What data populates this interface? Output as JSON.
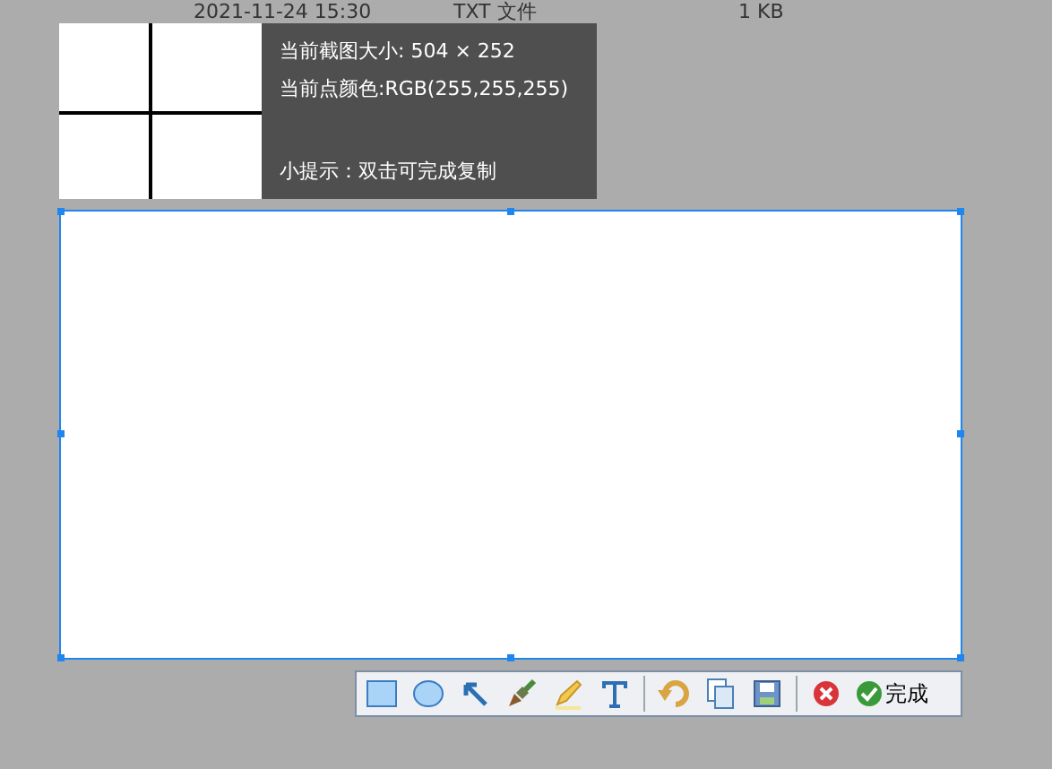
{
  "file_row": {
    "date": "2021-11-24 15:30",
    "type": "TXT 文件",
    "size": "1 KB"
  },
  "info": {
    "size_line": "当前截图大小: 504 × 252",
    "color_line": "当前点颜色:RGB(255,255,255)",
    "hint": "小提示：双击可完成复制"
  },
  "toolbar": {
    "tools": [
      {
        "kind": "rectangle"
      },
      {
        "kind": "ellipse"
      },
      {
        "kind": "arrow"
      },
      {
        "kind": "brush"
      },
      {
        "kind": "pencil"
      },
      {
        "kind": "text"
      },
      {
        "kind": "separator"
      },
      {
        "kind": "undo"
      },
      {
        "kind": "copy"
      },
      {
        "kind": "save"
      },
      {
        "kind": "separator"
      },
      {
        "kind": "cancel"
      }
    ],
    "done_label": "完成"
  }
}
